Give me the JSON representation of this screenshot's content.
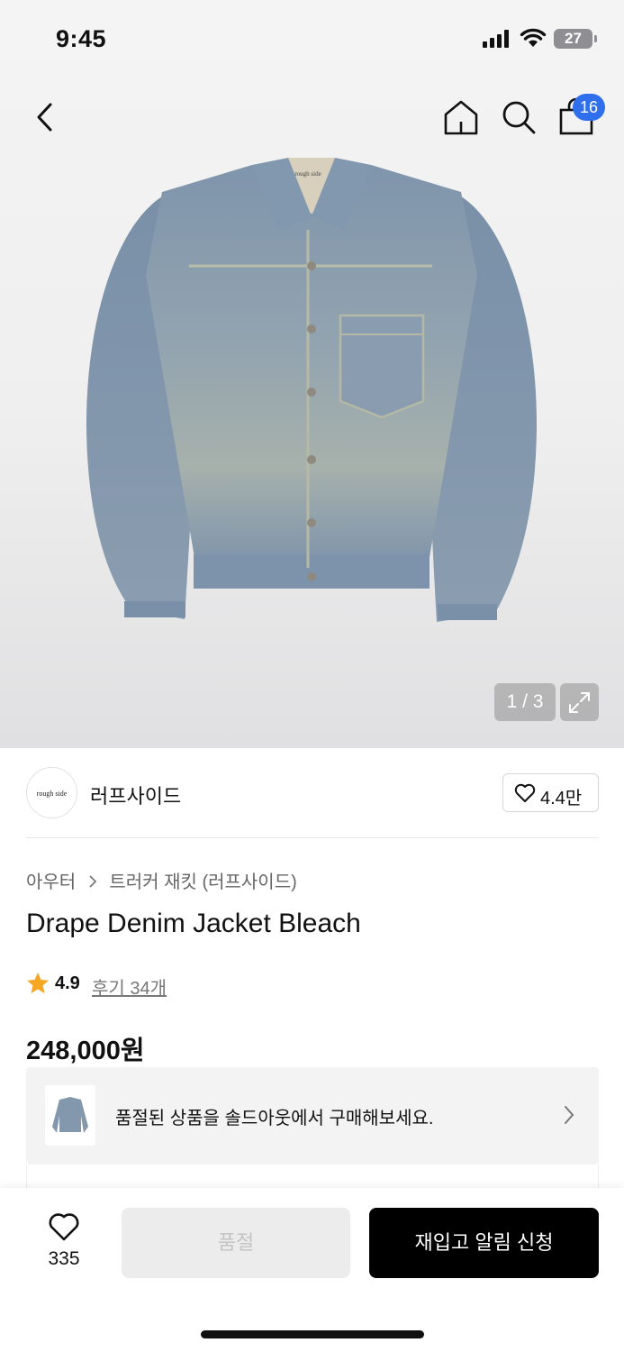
{
  "status_bar": {
    "time": "9:45",
    "battery": "27"
  },
  "header": {
    "cart_count": "16"
  },
  "gallery": {
    "pager": "1 / 3",
    "collar_tag": "rough side"
  },
  "brand": {
    "logo_text": "rough side",
    "name": "러프사이드",
    "likes": "4.4만"
  },
  "breadcrumb": {
    "category": "아우터",
    "subcategory": "트러커 재킷 (러프사이드)"
  },
  "product": {
    "title": "Drape Denim Jacket Bleach",
    "rating": "4.9",
    "reviews": "후기 34개",
    "price": "248,000원"
  },
  "soldout_banner": {
    "text": "품절된 상품을 솔드아웃에서 구매해보세요."
  },
  "bottom_bar": {
    "wish_count": "335",
    "soldout_label": "품절",
    "restock_label": "재입고 알림 신청"
  },
  "colors": {
    "accent_blue": "#2f6fec",
    "star": "#f5a623",
    "cta": "#000000"
  }
}
